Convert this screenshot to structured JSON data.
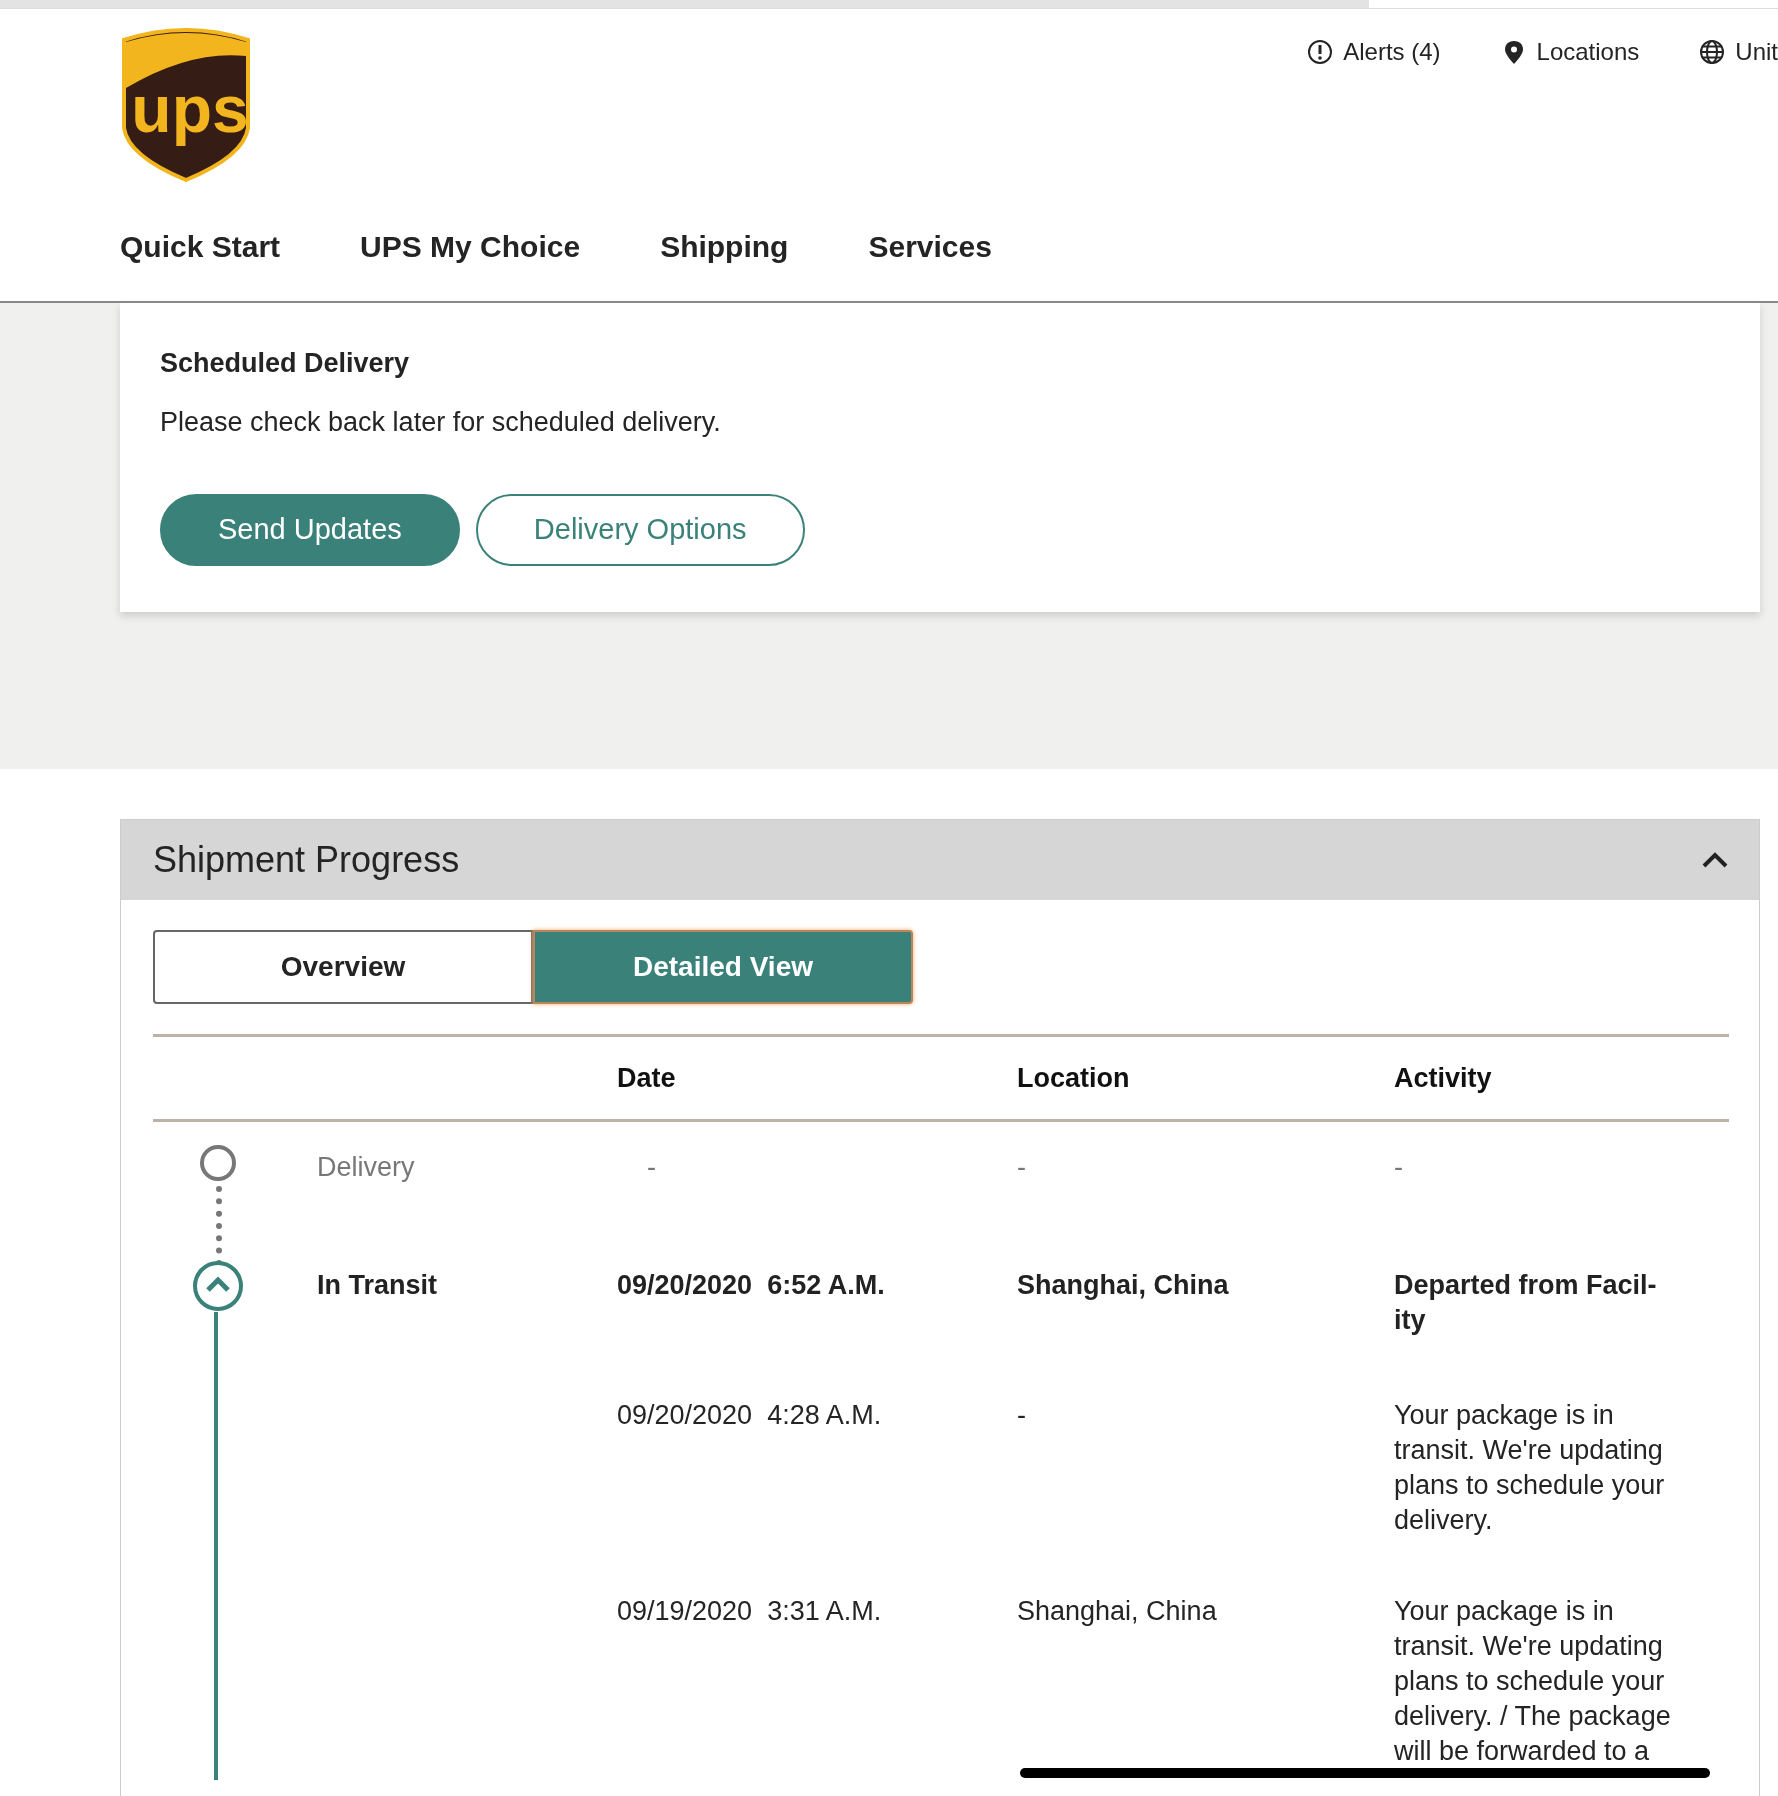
{
  "load_bar": {
    "level": 0.77
  },
  "logo": {
    "text": "ups"
  },
  "utility_links": [
    {
      "kind": "alert",
      "label": "Alerts (4)"
    },
    {
      "kind": "pin",
      "label": "Locations"
    },
    {
      "kind": "globe",
      "label": "Unit"
    }
  ],
  "nav": [
    "Quick Start",
    "UPS My Choice",
    "Shipping",
    "Services"
  ],
  "scheduled_delivery": {
    "title": "Scheduled Delivery",
    "message": "Please check back later for scheduled delivery.",
    "buttons": [
      {
        "label": "Send Updates",
        "kind": "primary"
      },
      {
        "label": "Delivery Options",
        "kind": "outline"
      }
    ]
  },
  "shipment_progress": {
    "title": "Shipment Progress",
    "expanded": true,
    "tabs": [
      {
        "label": "Overview",
        "selected": false
      },
      {
        "label": "Detailed View",
        "selected": true
      }
    ],
    "columns": [
      "Date",
      "Location",
      "Activity"
    ],
    "events": [
      {
        "kind": "pending",
        "status": "Delivery",
        "date": "-",
        "location": "-",
        "activity": "-"
      },
      {
        "kind": "current",
        "status": "In Transit",
        "date": "09/20/2020  6:52 A.M.",
        "location": "Shanghai, China",
        "activity": "Departed from Facil-ity"
      },
      {
        "kind": "detail",
        "date": "09/20/2020  4:28 A.M.",
        "location": "-",
        "activity": "Your package is in transit. We're updating plans to schedule your delivery."
      },
      {
        "kind": "detail",
        "date": "09/19/2020  3:31 A.M.",
        "location": "Shanghai, China",
        "activity": "Your package is in transit. We're updating plans to schedule your delivery. / The package will be forwarded to a"
      }
    ]
  }
}
